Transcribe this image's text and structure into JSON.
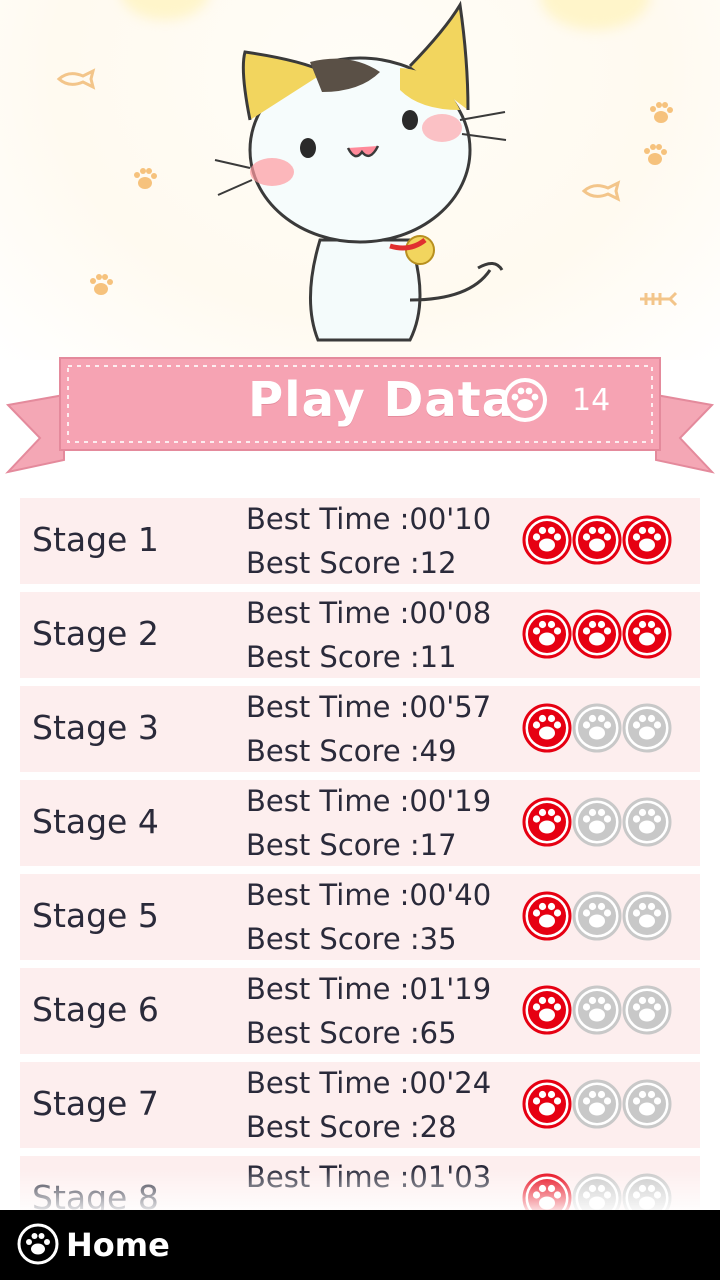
{
  "header": {
    "title": "Play Data",
    "paw_count": "14"
  },
  "colors": {
    "banner_pink": "#f6a3b3",
    "row_bg": "#fdeeee",
    "paw_red": "#e60012",
    "paw_gray": "#c8c8c8"
  },
  "stages": [
    {
      "label": "Stage 1",
      "best_time": "Best Time :00'10",
      "best_score": "Best Score :12",
      "paws_earned": 3
    },
    {
      "label": "Stage 2",
      "best_time": "Best Time :00'08",
      "best_score": "Best Score :11",
      "paws_earned": 3
    },
    {
      "label": "Stage 3",
      "best_time": "Best Time :00'57",
      "best_score": "Best Score :49",
      "paws_earned": 1
    },
    {
      "label": "Stage 4",
      "best_time": "Best Time :00'19",
      "best_score": "Best Score :17",
      "paws_earned": 1
    },
    {
      "label": "Stage 5",
      "best_time": "Best Time :00'40",
      "best_score": "Best Score :35",
      "paws_earned": 1
    },
    {
      "label": "Stage 6",
      "best_time": "Best Time :01'19",
      "best_score": "Best Score :65",
      "paws_earned": 1
    },
    {
      "label": "Stage 7",
      "best_time": "Best Time :00'24",
      "best_score": "Best Score :28",
      "paws_earned": 1
    },
    {
      "label": "Stage 8",
      "best_time": "Best Time :01'03",
      "best_score": "",
      "paws_earned": 1
    }
  ],
  "footer": {
    "home_label": "Home",
    "home_icon": "paw-icon"
  }
}
